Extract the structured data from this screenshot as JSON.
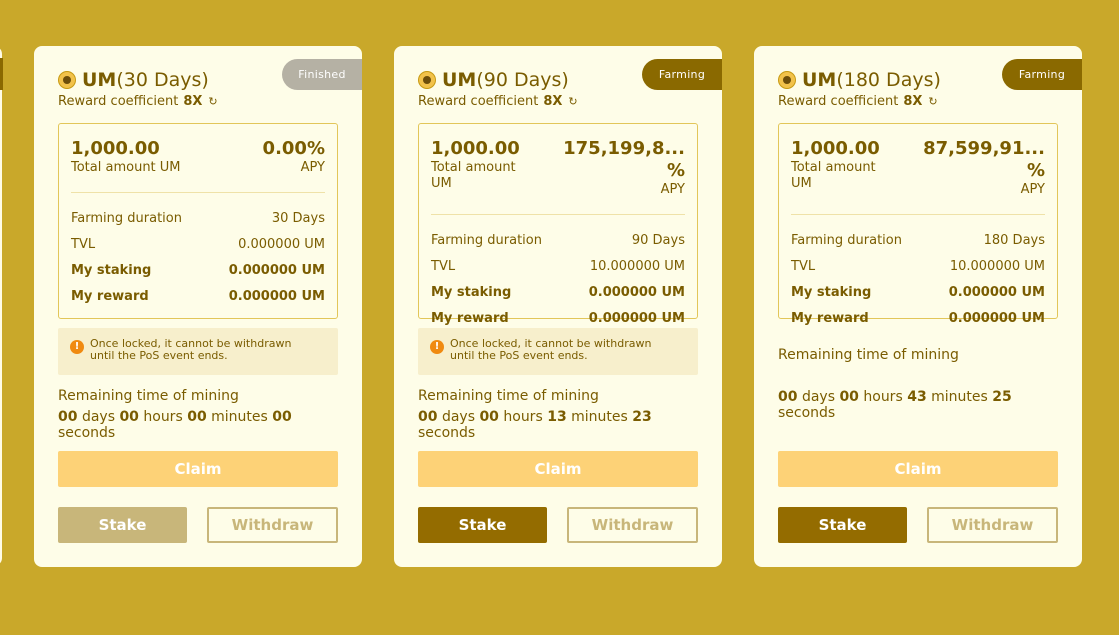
{
  "cards": [
    {
      "token": "UM",
      "duration_label": "(30 Days)",
      "status": "Finished",
      "coef_label": "Reward coefficient",
      "coef_value": "8X",
      "total_amount": "1,000.00",
      "total_amount_label": "Total amount UM",
      "apy": "0.00%",
      "apy_label": "APY",
      "farming_duration_label": "Farming duration",
      "farming_duration": "30 Days",
      "tvl_label": "TVL",
      "tvl": "0.000000 UM",
      "my_staking_label": "My staking",
      "my_staking": "0.000000 UM",
      "my_reward_label": "My reward",
      "my_reward": "0.000000 UM",
      "warning_line1": "Once locked, it cannot be withdrawn",
      "warning_line2": "until the PoS event ends.",
      "remaining_label": "Remaining time of mining",
      "days": "00",
      "hours": "00",
      "minutes": "00",
      "seconds": "00",
      "claim_label": "Claim",
      "stake_label": "Stake",
      "withdraw_label": "Withdraw"
    },
    {
      "token": "UM",
      "duration_label": "(90 Days)",
      "status": "Farming",
      "coef_label": "Reward coefficient",
      "coef_value": "8X",
      "total_amount": "1,000.00",
      "total_amount_label": "Total amount UM",
      "apy": "175,199,8... %",
      "apy_label": "APY",
      "farming_duration_label": "Farming duration",
      "farming_duration": "90 Days",
      "tvl_label": "TVL",
      "tvl": "10.000000 UM",
      "my_staking_label": "My staking",
      "my_staking": "0.000000 UM",
      "my_reward_label": "My reward",
      "my_reward": "0.000000 UM",
      "warning_line1": "Once locked, it cannot be withdrawn",
      "warning_line2": "until the PoS event ends.",
      "remaining_label": "Remaining time of mining",
      "days": "00",
      "hours": "00",
      "minutes": "13",
      "seconds": "23",
      "claim_label": "Claim",
      "stake_label": "Stake",
      "withdraw_label": "Withdraw"
    },
    {
      "token": "UM",
      "duration_label": "(180 Days)",
      "status": "Farming",
      "coef_label": "Reward coefficient",
      "coef_value": "8X",
      "total_amount": "1,000.00",
      "total_amount_label": "Total amount UM",
      "apy": "87,599,91... %",
      "apy_label": "APY",
      "farming_duration_label": "Farming duration",
      "farming_duration": "180 Days",
      "tvl_label": "TVL",
      "tvl": "10.000000 UM",
      "my_staking_label": "My staking",
      "my_staking": "0.000000 UM",
      "my_reward_label": "My reward",
      "my_reward": "0.000000 UM",
      "remaining_label": "Remaining time of mining",
      "days": "00",
      "hours": "00",
      "minutes": "43",
      "seconds": "25",
      "claim_label": "Claim",
      "stake_label": "Stake",
      "withdraw_label": "Withdraw"
    }
  ],
  "countdown_units": {
    "days": "days",
    "hours": "hours",
    "minutes": "minutes",
    "seconds": "seconds"
  },
  "icons": {
    "coin": "um-coin-icon",
    "refresh": "refresh-icon",
    "warning": "warning-icon"
  },
  "colors": {
    "background": "#c9a82a",
    "card": "#fefde8",
    "accent": "#8a6900",
    "claim": "#fdd277",
    "warning": "#f08a10"
  }
}
